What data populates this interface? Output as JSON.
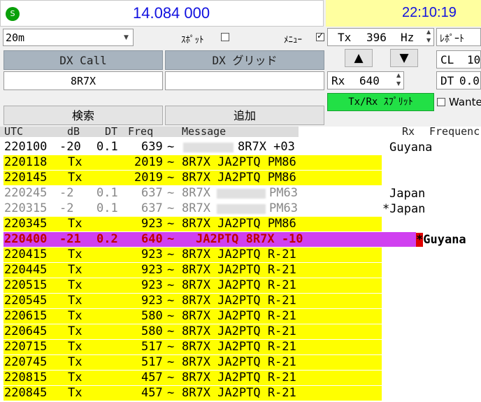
{
  "header": {
    "s_icon_label": "S",
    "dial_frequency": "14.084 000",
    "clock": "22:10:19"
  },
  "controls": {
    "band_value": "20m",
    "spot_label": "ｽﾎﾟｯﾄ",
    "menu_label": "ﾒﾆｭｰ",
    "menu_checked": true,
    "tx_label": "Tx",
    "tx_value": "396",
    "tx_unit": "Hz",
    "report_label": "ﾚﾎﾟｰﾄ",
    "cl_label": "CL",
    "cl_value": "10",
    "rx_label": "Rx",
    "rx_value": "640",
    "dt_label": "DT",
    "dt_value": "0.0",
    "up_arrow": "▲",
    "down_arrow": "▼",
    "split_label": "Tx/Rx ｽﾌﾟﾘｯﾄ",
    "wanted_label": "Wante",
    "dxcall_header": "DX Call",
    "dxgrid_header": "DX グリッド",
    "dxcall_value": "8R7X",
    "dxgrid_value": "",
    "search_label": "検索",
    "add_label": "追加"
  },
  "columns": {
    "utc": "UTC",
    "db": "dB",
    "dt": "DT",
    "freq": "Freq",
    "message": "Message",
    "rx": "Rx",
    "frequency": "Frequenc"
  },
  "rows": [
    {
      "utc": "220100",
      "db": "-20",
      "dt": "0.1",
      "freq": "639",
      "sep": "~",
      "msg_pre": "",
      "msg": "8R7X +03",
      "style": "white",
      "country": "Guyana",
      "redacted": true
    },
    {
      "utc": "220118",
      "db": "Tx",
      "dt": "",
      "freq": "2019",
      "sep": "~",
      "msg_pre": "8R7X",
      "msg": "JA2PTQ PM86",
      "style": "yellow",
      "country": ""
    },
    {
      "utc": "220145",
      "db": "Tx",
      "dt": "",
      "freq": "2019",
      "sep": "~",
      "msg_pre": "8R7X",
      "msg": "JA2PTQ PM86",
      "style": "yellow",
      "country": ""
    },
    {
      "utc": "220245",
      "db": "-2",
      "dt": "0.1",
      "freq": "637",
      "sep": "~",
      "msg_pre": "8R7X",
      "msg": "PM63",
      "style": "gray",
      "country": "Japan",
      "redacted": true
    },
    {
      "utc": "220315",
      "db": "-2",
      "dt": "0.1",
      "freq": "637",
      "sep": "~",
      "msg_pre": "8R7X",
      "msg": "PM63",
      "style": "gray",
      "country": "*Japan",
      "redacted": true
    },
    {
      "utc": "220345",
      "db": "Tx",
      "dt": "",
      "freq": "923",
      "sep": "~",
      "msg_pre": "8R7X",
      "msg": "JA2PTQ PM86",
      "style": "yellow",
      "country": ""
    },
    {
      "utc": "220400",
      "db": "-21",
      "dt": "0.2",
      "freq": "640",
      "sep": "~",
      "msg_pre": "JA2PTQ",
      "msg": "8R7X -10",
      "style": "magenta",
      "country": "*Guyana"
    },
    {
      "utc": "220415",
      "db": "Tx",
      "dt": "",
      "freq": "923",
      "sep": "~",
      "msg_pre": "8R7X",
      "msg": "JA2PTQ R-21",
      "style": "yellow",
      "country": ""
    },
    {
      "utc": "220445",
      "db": "Tx",
      "dt": "",
      "freq": "923",
      "sep": "~",
      "msg_pre": "8R7X",
      "msg": "JA2PTQ R-21",
      "style": "yellow",
      "country": ""
    },
    {
      "utc": "220515",
      "db": "Tx",
      "dt": "",
      "freq": "923",
      "sep": "~",
      "msg_pre": "8R7X",
      "msg": "JA2PTQ R-21",
      "style": "yellow",
      "country": ""
    },
    {
      "utc": "220545",
      "db": "Tx",
      "dt": "",
      "freq": "923",
      "sep": "~",
      "msg_pre": "8R7X",
      "msg": "JA2PTQ R-21",
      "style": "yellow",
      "country": ""
    },
    {
      "utc": "220615",
      "db": "Tx",
      "dt": "",
      "freq": "580",
      "sep": "~",
      "msg_pre": "8R7X",
      "msg": "JA2PTQ R-21",
      "style": "yellow",
      "country": ""
    },
    {
      "utc": "220645",
      "db": "Tx",
      "dt": "",
      "freq": "580",
      "sep": "~",
      "msg_pre": "8R7X",
      "msg": "JA2PTQ R-21",
      "style": "yellow",
      "country": ""
    },
    {
      "utc": "220715",
      "db": "Tx",
      "dt": "",
      "freq": "517",
      "sep": "~",
      "msg_pre": "8R7X",
      "msg": "JA2PTQ R-21",
      "style": "yellow",
      "country": ""
    },
    {
      "utc": "220745",
      "db": "Tx",
      "dt": "",
      "freq": "517",
      "sep": "~",
      "msg_pre": "8R7X",
      "msg": "JA2PTQ R-21",
      "style": "yellow",
      "country": ""
    },
    {
      "utc": "220815",
      "db": "Tx",
      "dt": "",
      "freq": "457",
      "sep": "~",
      "msg_pre": "8R7X",
      "msg": "JA2PTQ R-21",
      "style": "yellow",
      "country": ""
    },
    {
      "utc": "220845",
      "db": "Tx",
      "dt": "",
      "freq": "457",
      "sep": "~",
      "msg_pre": "8R7X",
      "msg": "JA2PTQ R-21",
      "style": "yellow",
      "country": ""
    }
  ],
  "colors": {
    "tx_row": "#ffff00",
    "highlight_row": "#d040f0",
    "split_button": "#22e046",
    "freq_text": "#1010e0",
    "clock_bg": "#ffff9f"
  }
}
